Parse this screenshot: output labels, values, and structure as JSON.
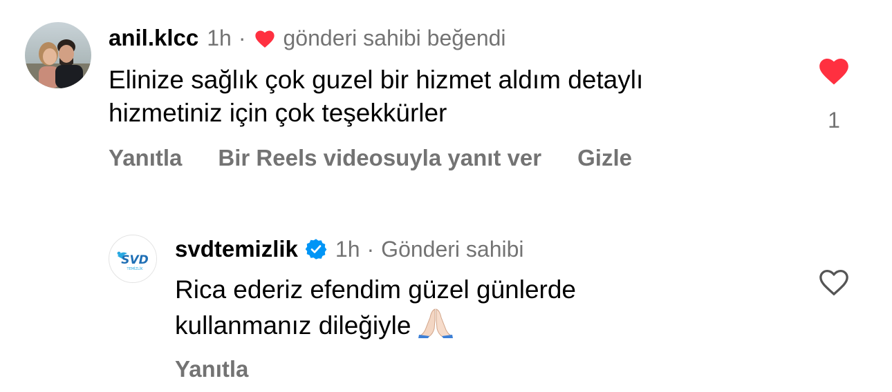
{
  "comments": [
    {
      "username": "anil.klcc",
      "time": "1h",
      "separator": "·",
      "liked_by_author_text": "gönderi sahibi beğendi",
      "text_line1": "Elinize sağlık çok guzel bir hizmet aldım detaylı",
      "text_line2": "hizmetiniz için çok teşekkürler",
      "like_count": "1",
      "liked": true,
      "actions": {
        "reply": "Yanıtla",
        "reels_reply": "Bir Reels videosuyla yanıt ver",
        "hide": "Gizle"
      }
    },
    {
      "username": "svdtemizlik",
      "verified": true,
      "time": "1h",
      "separator": "·",
      "author_badge": "Gönderi sahibi",
      "text_line1": "Rica ederiz efendim güzel günlerde",
      "text_line2": "kullanmanız dileğiyle",
      "emoji": "folded-hands",
      "liked": false,
      "avatar_logo_text": "SVD",
      "avatar_logo_subtext": "TEMİZLİK",
      "actions": {
        "reply": "Yanıtla"
      }
    }
  ],
  "colors": {
    "heart_red": "#ff3040",
    "verified_blue": "#0095f6",
    "secondary_text": "#737373",
    "logo_blue": "#1f6fb5",
    "logo_cyan": "#29a9e1"
  }
}
